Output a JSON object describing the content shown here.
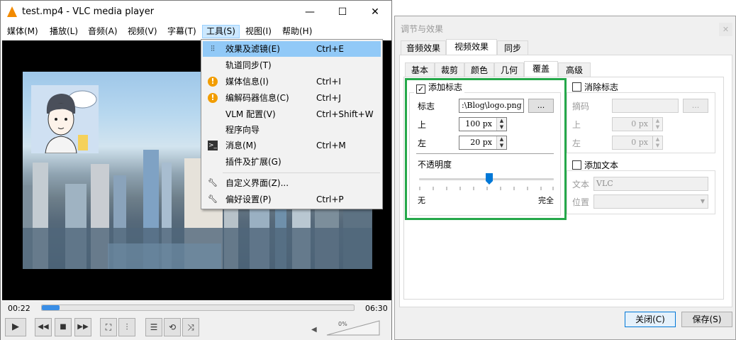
{
  "vlc": {
    "title": "test.mp4 - VLC media player",
    "menu": [
      "媒体(M)",
      "播放(L)",
      "音频(A)",
      "视频(V)",
      "字幕(T)",
      "工具(S)",
      "视图(I)",
      "帮助(H)"
    ],
    "elapsed": "00:22",
    "total": "06:30",
    "progress": 0.056,
    "volume_percent": "0%",
    "window_controls": [
      "minimize-icon",
      "maximize-icon",
      "close-icon"
    ],
    "controls": [
      "play-icon",
      "prev-icon",
      "stop-icon",
      "next-icon",
      "fullscreen-icon",
      "extended-settings-icon",
      "playlist-icon",
      "loop-icon",
      "shuffle-icon"
    ]
  },
  "tools_menu": {
    "items": [
      {
        "label": "效果及滤镜(E)",
        "shortcut": "Ctrl+E",
        "icon": "sliders-icon",
        "highlighted": true
      },
      {
        "label": "轨道同步(T)",
        "shortcut": "",
        "icon": ""
      },
      {
        "label": "媒体信息(I)",
        "shortcut": "Ctrl+I",
        "icon": "info-icon"
      },
      {
        "label": "编解码器信息(C)",
        "shortcut": "Ctrl+J",
        "icon": "info-icon"
      },
      {
        "label": "VLM 配置(V)",
        "shortcut": "Ctrl+Shift+W",
        "icon": ""
      },
      {
        "label": "程序向导",
        "shortcut": "",
        "icon": ""
      },
      {
        "label": "消息(M)",
        "shortcut": "Ctrl+M",
        "icon": "terminal-icon"
      },
      {
        "label": "插件及扩展(G)",
        "shortcut": "",
        "icon": ""
      },
      {
        "label": "自定义界面(Z)...",
        "shortcut": "",
        "icon": "wrench-icon"
      },
      {
        "label": "偏好设置(P)",
        "shortcut": "Ctrl+P",
        "icon": "wrench-icon"
      }
    ]
  },
  "dialog": {
    "title": "调节与效果",
    "close_glyph": "✕",
    "tabs": [
      "音频效果",
      "视频效果",
      "同步"
    ],
    "subtabs": [
      "基本",
      "裁剪",
      "颜色",
      "几何",
      "覆盖",
      "高级"
    ],
    "add_logo": {
      "title": "添加标志",
      "checked": true,
      "logo_label": "标志",
      "logo_value": ":\\Blog\\logo.png",
      "browse": "...",
      "top_label": "上",
      "top_value": "100 px",
      "left_label": "左",
      "left_value": "20 px",
      "opacity_label": "不透明度",
      "opacity_min": "无",
      "opacity_max": "完全",
      "opacity_level": 0.52
    },
    "remove_logo": {
      "title": "消除标志",
      "checked": false,
      "mask_label": "摘码",
      "browse": "...",
      "top_label": "上",
      "top_value": "0 px",
      "left_label": "左",
      "left_value": "0 px"
    },
    "add_text": {
      "title": "添加文本",
      "checked": false,
      "text_label": "文本",
      "text_value": "VLC",
      "position_label": "位置"
    },
    "close_button": "关闭(C)",
    "save_button": "保存(S)",
    "highlight_color": "#25a84a"
  }
}
